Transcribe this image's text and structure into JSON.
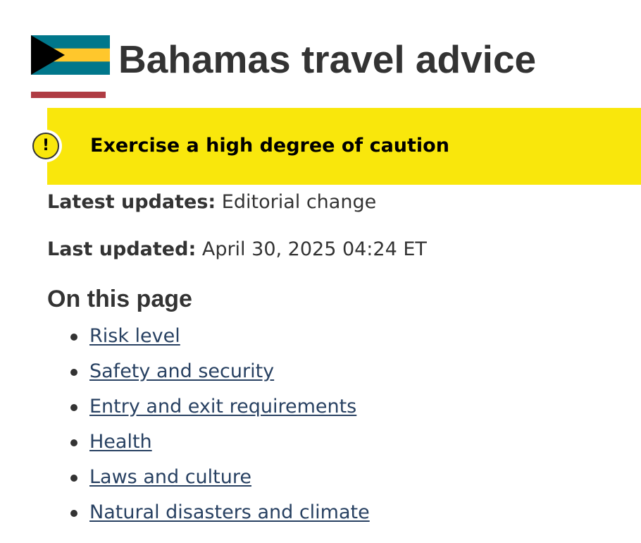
{
  "header": {
    "title": "Bahamas travel advice",
    "flag_icon": "bahamas-flag-icon"
  },
  "alert": {
    "icon": "exclamation-icon",
    "icon_glyph": "!",
    "text": "Exercise a high degree of caution",
    "background_color": "#f9e70c"
  },
  "meta": {
    "latest_updates_label": "Latest updates:",
    "latest_updates_value": "Editorial change",
    "last_updated_label": "Last updated:",
    "last_updated_value": "April 30, 2025 04:24 ET"
  },
  "toc": {
    "heading": "On this page",
    "items": [
      {
        "label": "Risk level"
      },
      {
        "label": "Safety and security"
      },
      {
        "label": "Entry and exit requirements"
      },
      {
        "label": "Health"
      },
      {
        "label": "Laws and culture"
      },
      {
        "label": "Natural disasters and climate"
      }
    ]
  },
  "colors": {
    "link": "#284162",
    "title_rule": "#af3c43",
    "text": "#333333",
    "flag_aquamarine": "#00778b",
    "flag_gold": "#ffc72c",
    "flag_black": "#000000"
  }
}
